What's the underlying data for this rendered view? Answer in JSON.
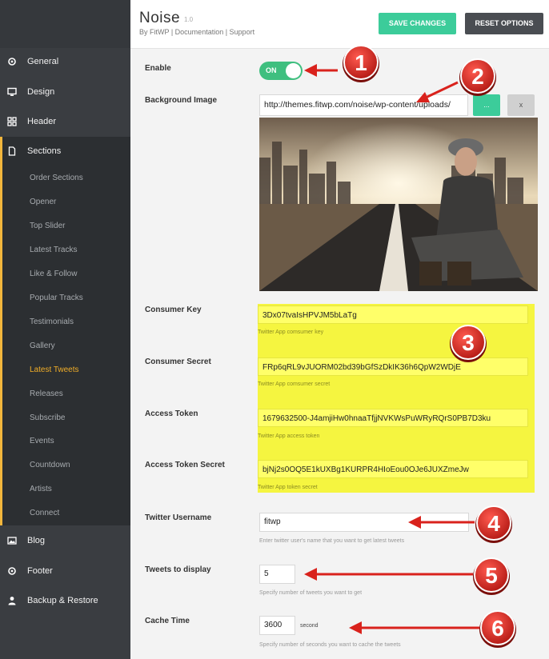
{
  "sidebar": {
    "main_items": [
      {
        "label": "General",
        "icon": "gear-icon"
      },
      {
        "label": "Design",
        "icon": "monitor-icon"
      },
      {
        "label": "Header",
        "icon": "grid-icon"
      },
      {
        "label": "Sections",
        "icon": "document-icon"
      },
      {
        "label": "Blog",
        "icon": "image-icon"
      },
      {
        "label": "Footer",
        "icon": "gear-icon"
      },
      {
        "label": "Backup & Restore",
        "icon": "user-icon"
      }
    ],
    "sub_items": [
      "Order Sections",
      "Opener",
      "Top Slider",
      "Latest Tracks",
      "Like & Follow",
      "Popular Tracks",
      "Testimonials",
      "Gallery",
      "Latest Tweets",
      "Releases",
      "Subscribe",
      "Events",
      "Countdown",
      "Artists",
      "Connect"
    ],
    "active_main": "Sections",
    "active_sub": "Latest Tweets"
  },
  "header": {
    "title": "Noise",
    "version": "1.0",
    "byline": "By FitWP | Documentation | Support",
    "save_label": "SAVE CHANGES",
    "reset_label": "RESET OPTIONS"
  },
  "fields": {
    "enable": {
      "label": "Enable",
      "value": "ON"
    },
    "background_image": {
      "label": "Background Image",
      "value": "http://themes.fitwp.com/noise/wp-content/uploads/",
      "upload_label": "...",
      "remove_label": "x"
    },
    "consumer_key": {
      "label": "Consumer Key",
      "value": "3Dx07tvaIsHPVJM5bLaTg",
      "help": "Twitter App comsumer key"
    },
    "consumer_secret": {
      "label": "Consumer Secret",
      "value": "FRp6qRL9vJUORM02bd39bGfSzDkIK36h6QpW2WDjE",
      "help": "Twitter App comsumer secret"
    },
    "access_token": {
      "label": "Access Token",
      "value": "1679632500-J4amjiHw0hnaaTfjjNVKWsPuWRyRQrS0PB7D3ku",
      "help": "Twitter App access token"
    },
    "access_token_secret": {
      "label": "Access Token Secret",
      "value": "bjNj2s0OQ5E1kUXBg1KURPR4HIoEou0OJe6JUXZmeJw",
      "help": "Twitter App token secret"
    },
    "twitter_username": {
      "label": "Twitter Username",
      "value": "fitwp",
      "help": "Enter twitter user's name that you want to get latest tweets"
    },
    "tweets_to_display": {
      "label": "Tweets to display",
      "value": "5",
      "help": "Specify number of tweets you want to get"
    },
    "cache_time": {
      "label": "Cache Time",
      "value": "3600",
      "unit": "second",
      "help": "Specify number of seconds you want to cache the tweets"
    }
  },
  "annotations": [
    "1",
    "2",
    "3",
    "4",
    "5",
    "6"
  ],
  "colors": {
    "sidebar": "#3a3d41",
    "accent": "#f0ad28",
    "save": "#3ccc9a",
    "reset": "#4a4d52",
    "toggle": "#3fbf7f",
    "highlight": "#f5f540",
    "badge": "#d9221c"
  }
}
